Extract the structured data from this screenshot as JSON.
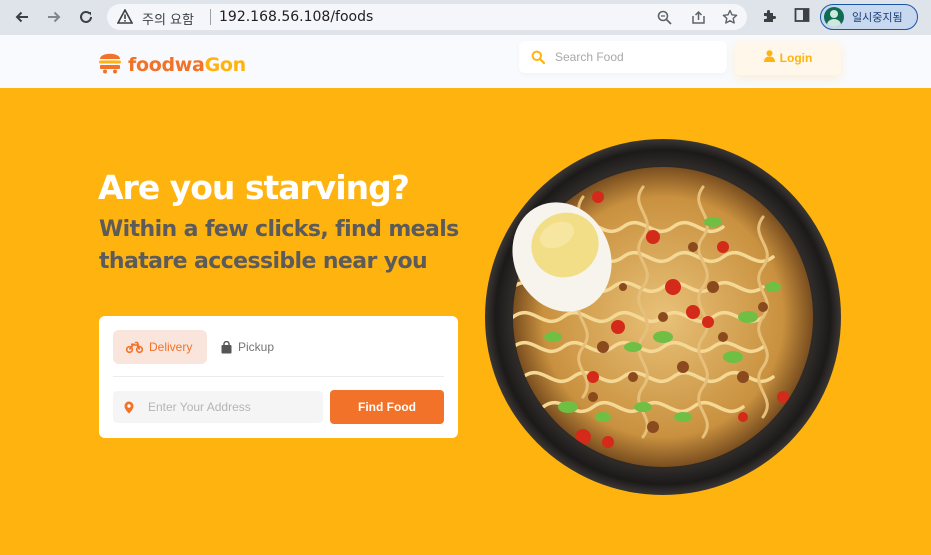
{
  "browser": {
    "security_label": "주의 요함",
    "url": "192.168.56.108/foods",
    "profile_label": "일시중지됨"
  },
  "header": {
    "logo_part1": "foodwa",
    "logo_part2": "Gon",
    "search_placeholder": "Search Food",
    "login_label": "Login"
  },
  "hero": {
    "title": "Are you starving?",
    "subtitle": "Within a few clicks, find meals thatare accessible near you"
  },
  "order_card": {
    "tabs": [
      {
        "label": "Delivery",
        "icon": "motorbike-icon",
        "active": true
      },
      {
        "label": "Pickup",
        "icon": "shopping-bag-icon",
        "active": false
      }
    ],
    "address_placeholder": "Enter Your Address",
    "find_button_label": "Find Food"
  },
  "colors": {
    "brand_orange": "#f17228",
    "brand_yellow": "#ffb30e",
    "subtitle_gray": "#5c5b5b"
  }
}
